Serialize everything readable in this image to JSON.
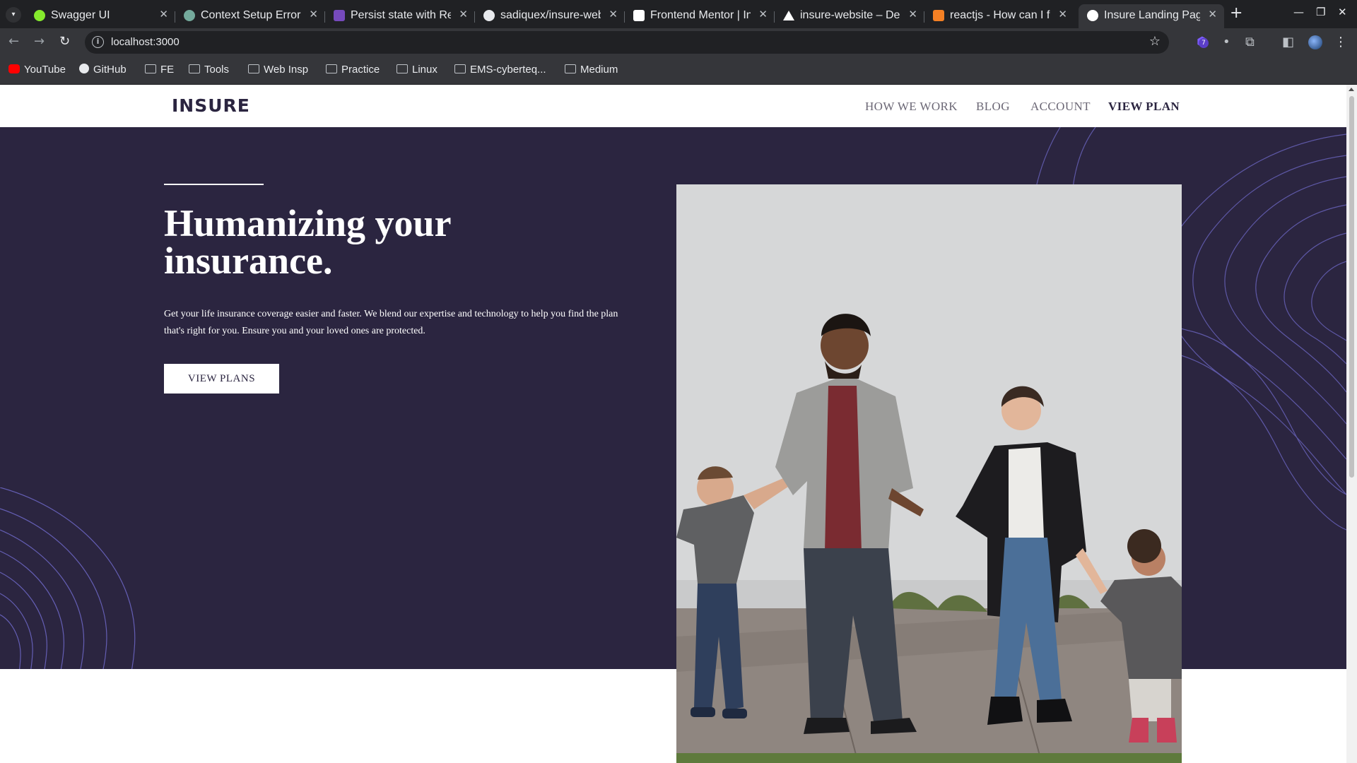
{
  "browser": {
    "tabs": [
      {
        "title": "Swagger UI",
        "favicon_color": "#85ea2d"
      },
      {
        "title": "Context Setup Error",
        "favicon_color": "#74aa9c"
      },
      {
        "title": "Persist state with Red",
        "favicon_color": "#764abc"
      },
      {
        "title": "sadiquex/insure-webs",
        "favicon_color": "#e8eaed"
      },
      {
        "title": "Frontend Mentor | In",
        "favicon_color": "#ffffff"
      },
      {
        "title": "insure-website – Dep",
        "favicon_color": "#000000"
      },
      {
        "title": "reactjs - How can I fix",
        "favicon_color": "#f48024"
      },
      {
        "title": "Insure Landing Page",
        "favicon_color": "#000000",
        "active": true
      }
    ],
    "url": "localhost:3000",
    "extension_badge": "7",
    "bookmarks": [
      {
        "label": "YouTube",
        "icon": "youtube-icon"
      },
      {
        "label": "GitHub",
        "icon": "github-icon"
      },
      {
        "label": "FE",
        "icon": "folder-icon"
      },
      {
        "label": "Tools",
        "icon": "folder-icon"
      },
      {
        "label": "Web Insp",
        "icon": "folder-icon"
      },
      {
        "label": "Practice",
        "icon": "folder-icon"
      },
      {
        "label": "Linux",
        "icon": "folder-icon"
      },
      {
        "label": "EMS-cyberteq...",
        "icon": "folder-icon"
      },
      {
        "label": "Medium",
        "icon": "folder-icon"
      }
    ]
  },
  "site": {
    "logo": "INSURE",
    "nav": [
      "HOW WE WORK",
      "BLOG",
      "ACCOUNT",
      "VIEW PLAN"
    ],
    "hero": {
      "title": "Humanizing your insurance.",
      "text": "Get your life insurance coverage easier and faster. We blend our expertise and technology to help you find the plan that's right for you. Ensure you and your loved ones are protected.",
      "button": "VIEW PLANS",
      "image_description": "family of four walking hand in hand in front of a white wall"
    },
    "colors": {
      "dark_violet": "#2b2540",
      "white": "#ffffff",
      "pattern_line": "#6f69c9"
    }
  }
}
